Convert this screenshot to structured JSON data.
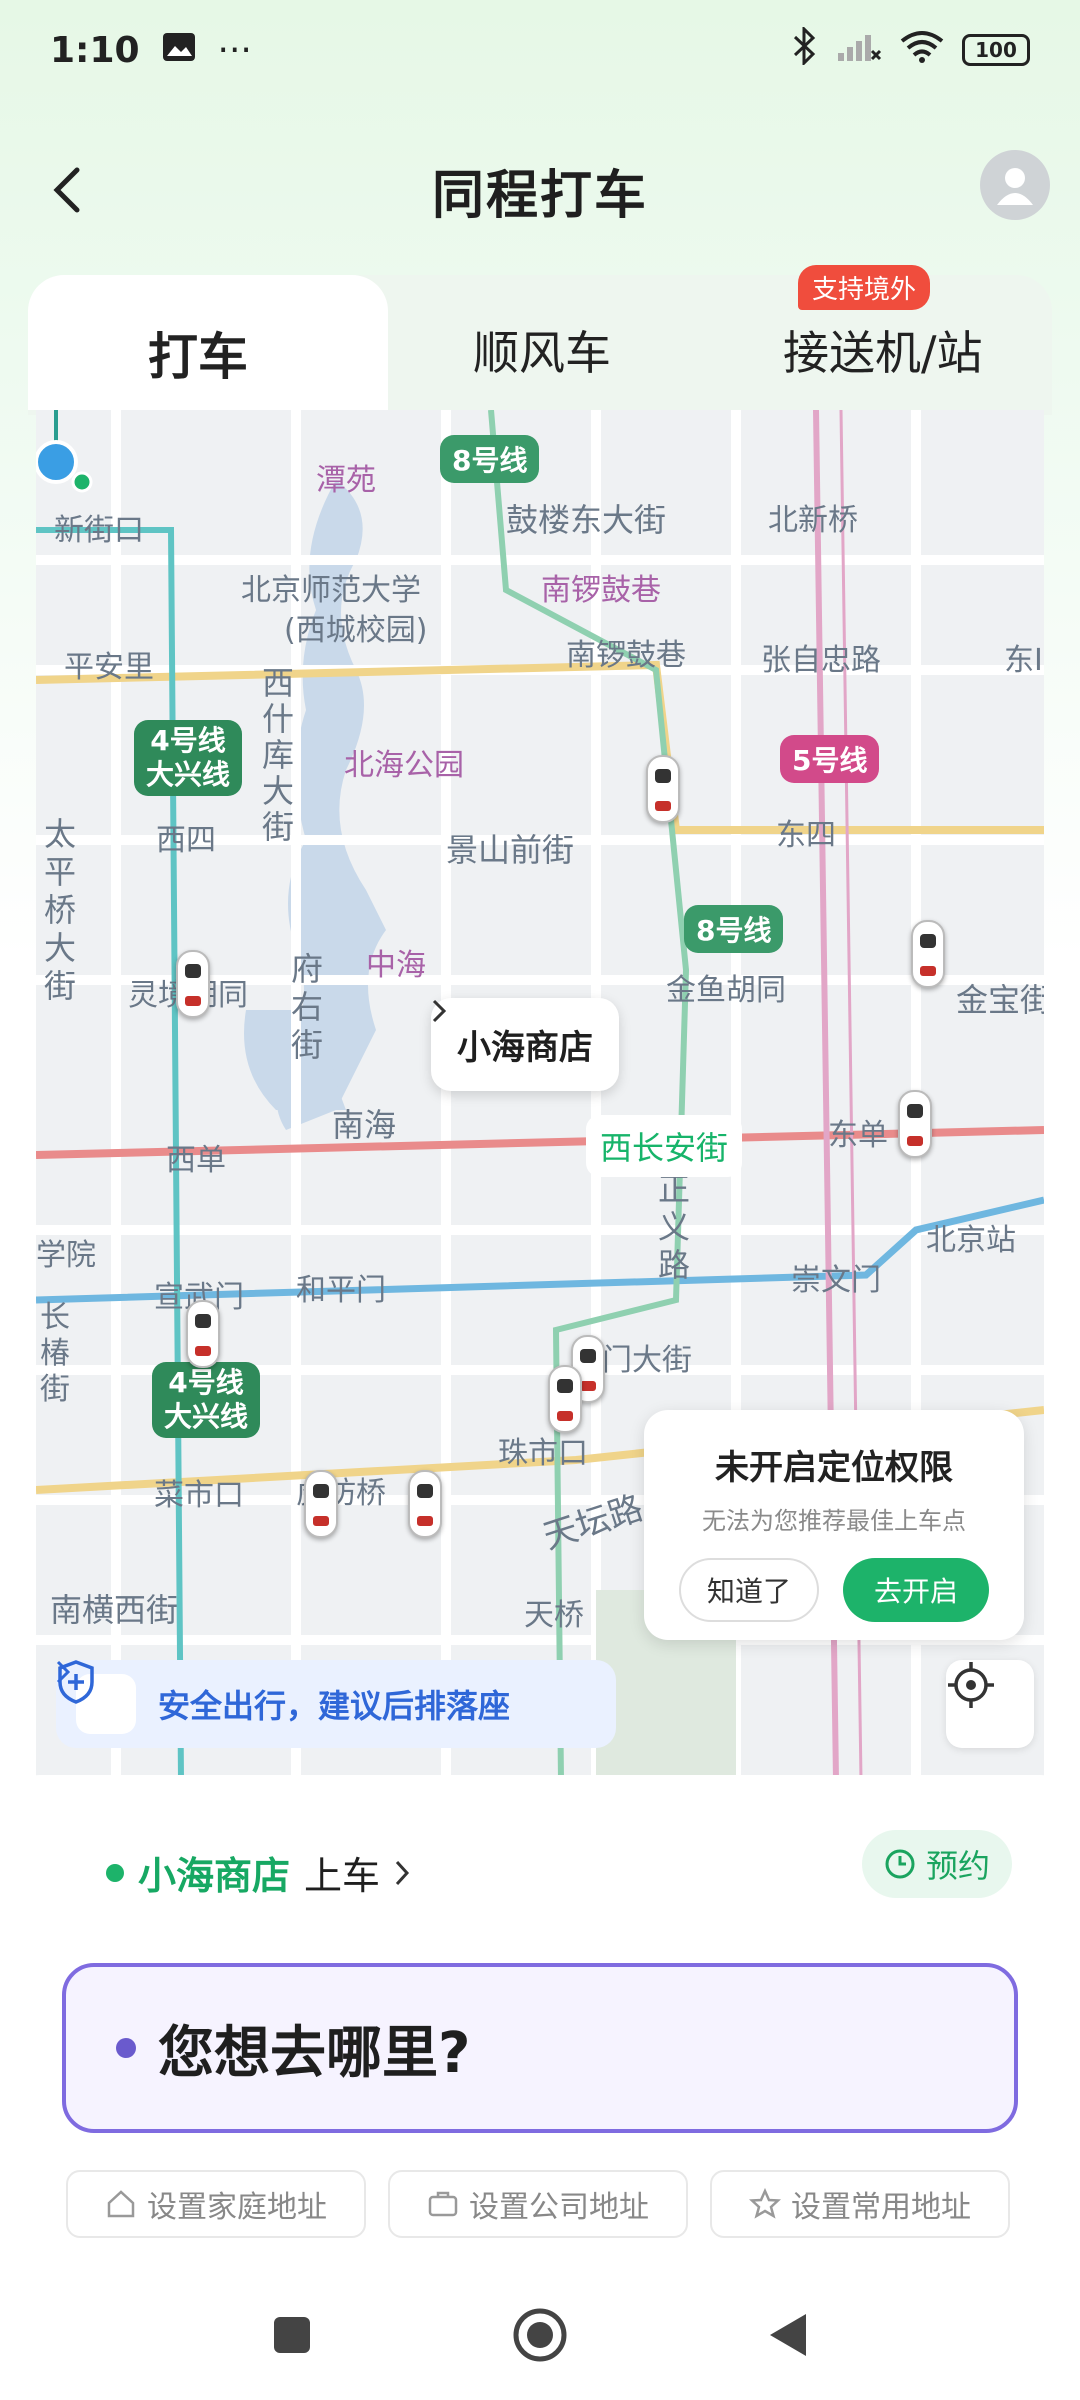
{
  "status_bar": {
    "time": "1:10",
    "dots": "···",
    "battery": "100"
  },
  "header": {
    "title": "同程打车"
  },
  "tabs": [
    {
      "label": "打车"
    },
    {
      "label": "顺风车"
    },
    {
      "label": "接送机/站"
    }
  ],
  "tab_badge": "支持境外",
  "map": {
    "labels": {
      "tanyuan": "潭苑",
      "gulou": "鼓楼东大街",
      "beixinqiao": "北新桥",
      "xinjiekou": "新街口",
      "bnu": "北京师范大学",
      "bnu2": "(西城校园)",
      "nanluoguxiang": "南锣鼓巷",
      "nanluoguxiang2": "南锣鼓巷",
      "pinganli": "平安里",
      "zhangzizhonglu": "张自忠路",
      "dong": "东I",
      "xishikuda": "西什库大街",
      "beihai": "北海公园",
      "xisi": "西四",
      "jingshanqian": "景山前街",
      "dongsi": "东四",
      "taipingqiao": "太平桥大街",
      "fuyoujie": "府右街",
      "zhonghai": "中海",
      "jinyu": "金鱼胡同",
      "jinbao": "金宝街",
      "lingjing": "灵境胡同",
      "nanhai": "南海",
      "xidan": "西单",
      "dongdan": "东单",
      "xianwumen": "宣武门",
      "hepingmen": "和平门",
      "chongwenmen": "崇文门",
      "beijingzhan": "北京站",
      "zhengyilu": "正义路",
      "qianmen": "前门大街",
      "zhushikou": "珠市口",
      "caishikou": "菜市口",
      "hufangqiao": "虎坊桥",
      "tiantan": "天坛路",
      "tianqiao": "天桥",
      "nanheng": "南横西街",
      "changchun": "长椿街",
      "yuan": "学院"
    },
    "line_badges": {
      "line8_top": "8号线",
      "line5": "5号线",
      "line8_mid": "8号线",
      "line4_top": "4号线\n大兴线",
      "line4_bottom": "4号线\n大兴线"
    },
    "line_colors": {
      "line4": "#3db6b6",
      "line8": "#5cb98e",
      "line5": "#d24a8a",
      "line1": "#e64a4a",
      "line2": "#4aa0d8"
    },
    "pickup_bubble": "小海商店",
    "street_tag": "西长安街",
    "permission": {
      "title": "未开启定位权限",
      "subtitle": "无法为您推荐最佳上车点",
      "dismiss": "知道了",
      "enable": "去开启"
    },
    "safety_text": "安全出行，建议后排落座"
  },
  "sheet": {
    "pickup_place": "小海商店",
    "pickup_suffix": "上车",
    "reserve_label": "预约",
    "destination_placeholder": "您想去哪里?",
    "quick": [
      {
        "label": "设置家庭地址",
        "icon": "home-icon"
      },
      {
        "label": "设置公司地址",
        "icon": "briefcase-icon"
      },
      {
        "label": "设置常用地址",
        "icon": "star-icon"
      }
    ]
  },
  "accent_green": "#1db36a",
  "accent_purple": "#7f6be0"
}
